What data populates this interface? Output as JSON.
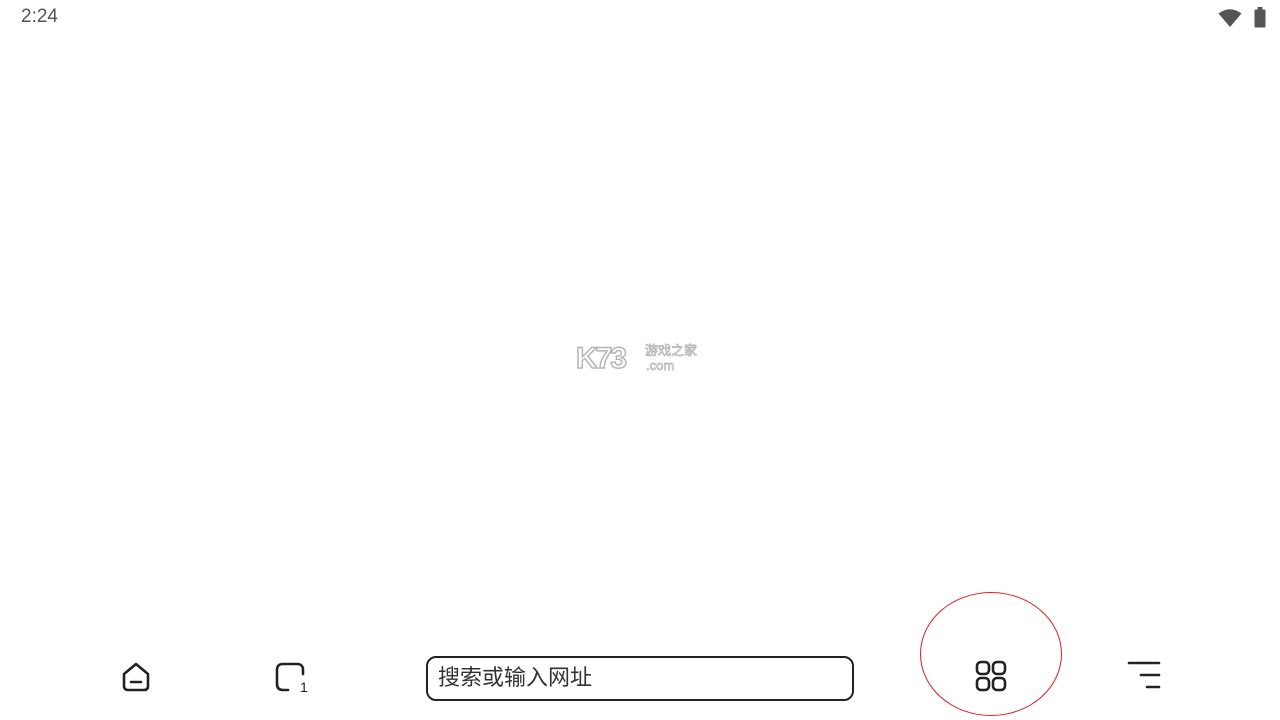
{
  "status_bar": {
    "time": "2:24",
    "icons": [
      "wifi-icon",
      "battery-icon"
    ]
  },
  "watermark": {
    "logo": "K73",
    "cn": "游戏之家",
    "com": ".com"
  },
  "toolbar": {
    "home_icon": "home-icon",
    "tabs_icon": "tabs-icon",
    "tabs_count": "1",
    "search_placeholder": "搜索或输入网址",
    "apps_icon": "apps-grid-icon",
    "menu_icon": "menu-icon"
  },
  "colors": {
    "icon": "#222222",
    "status_text": "#555555",
    "highlight": "#dd1f1f",
    "background": "#ffffff"
  }
}
